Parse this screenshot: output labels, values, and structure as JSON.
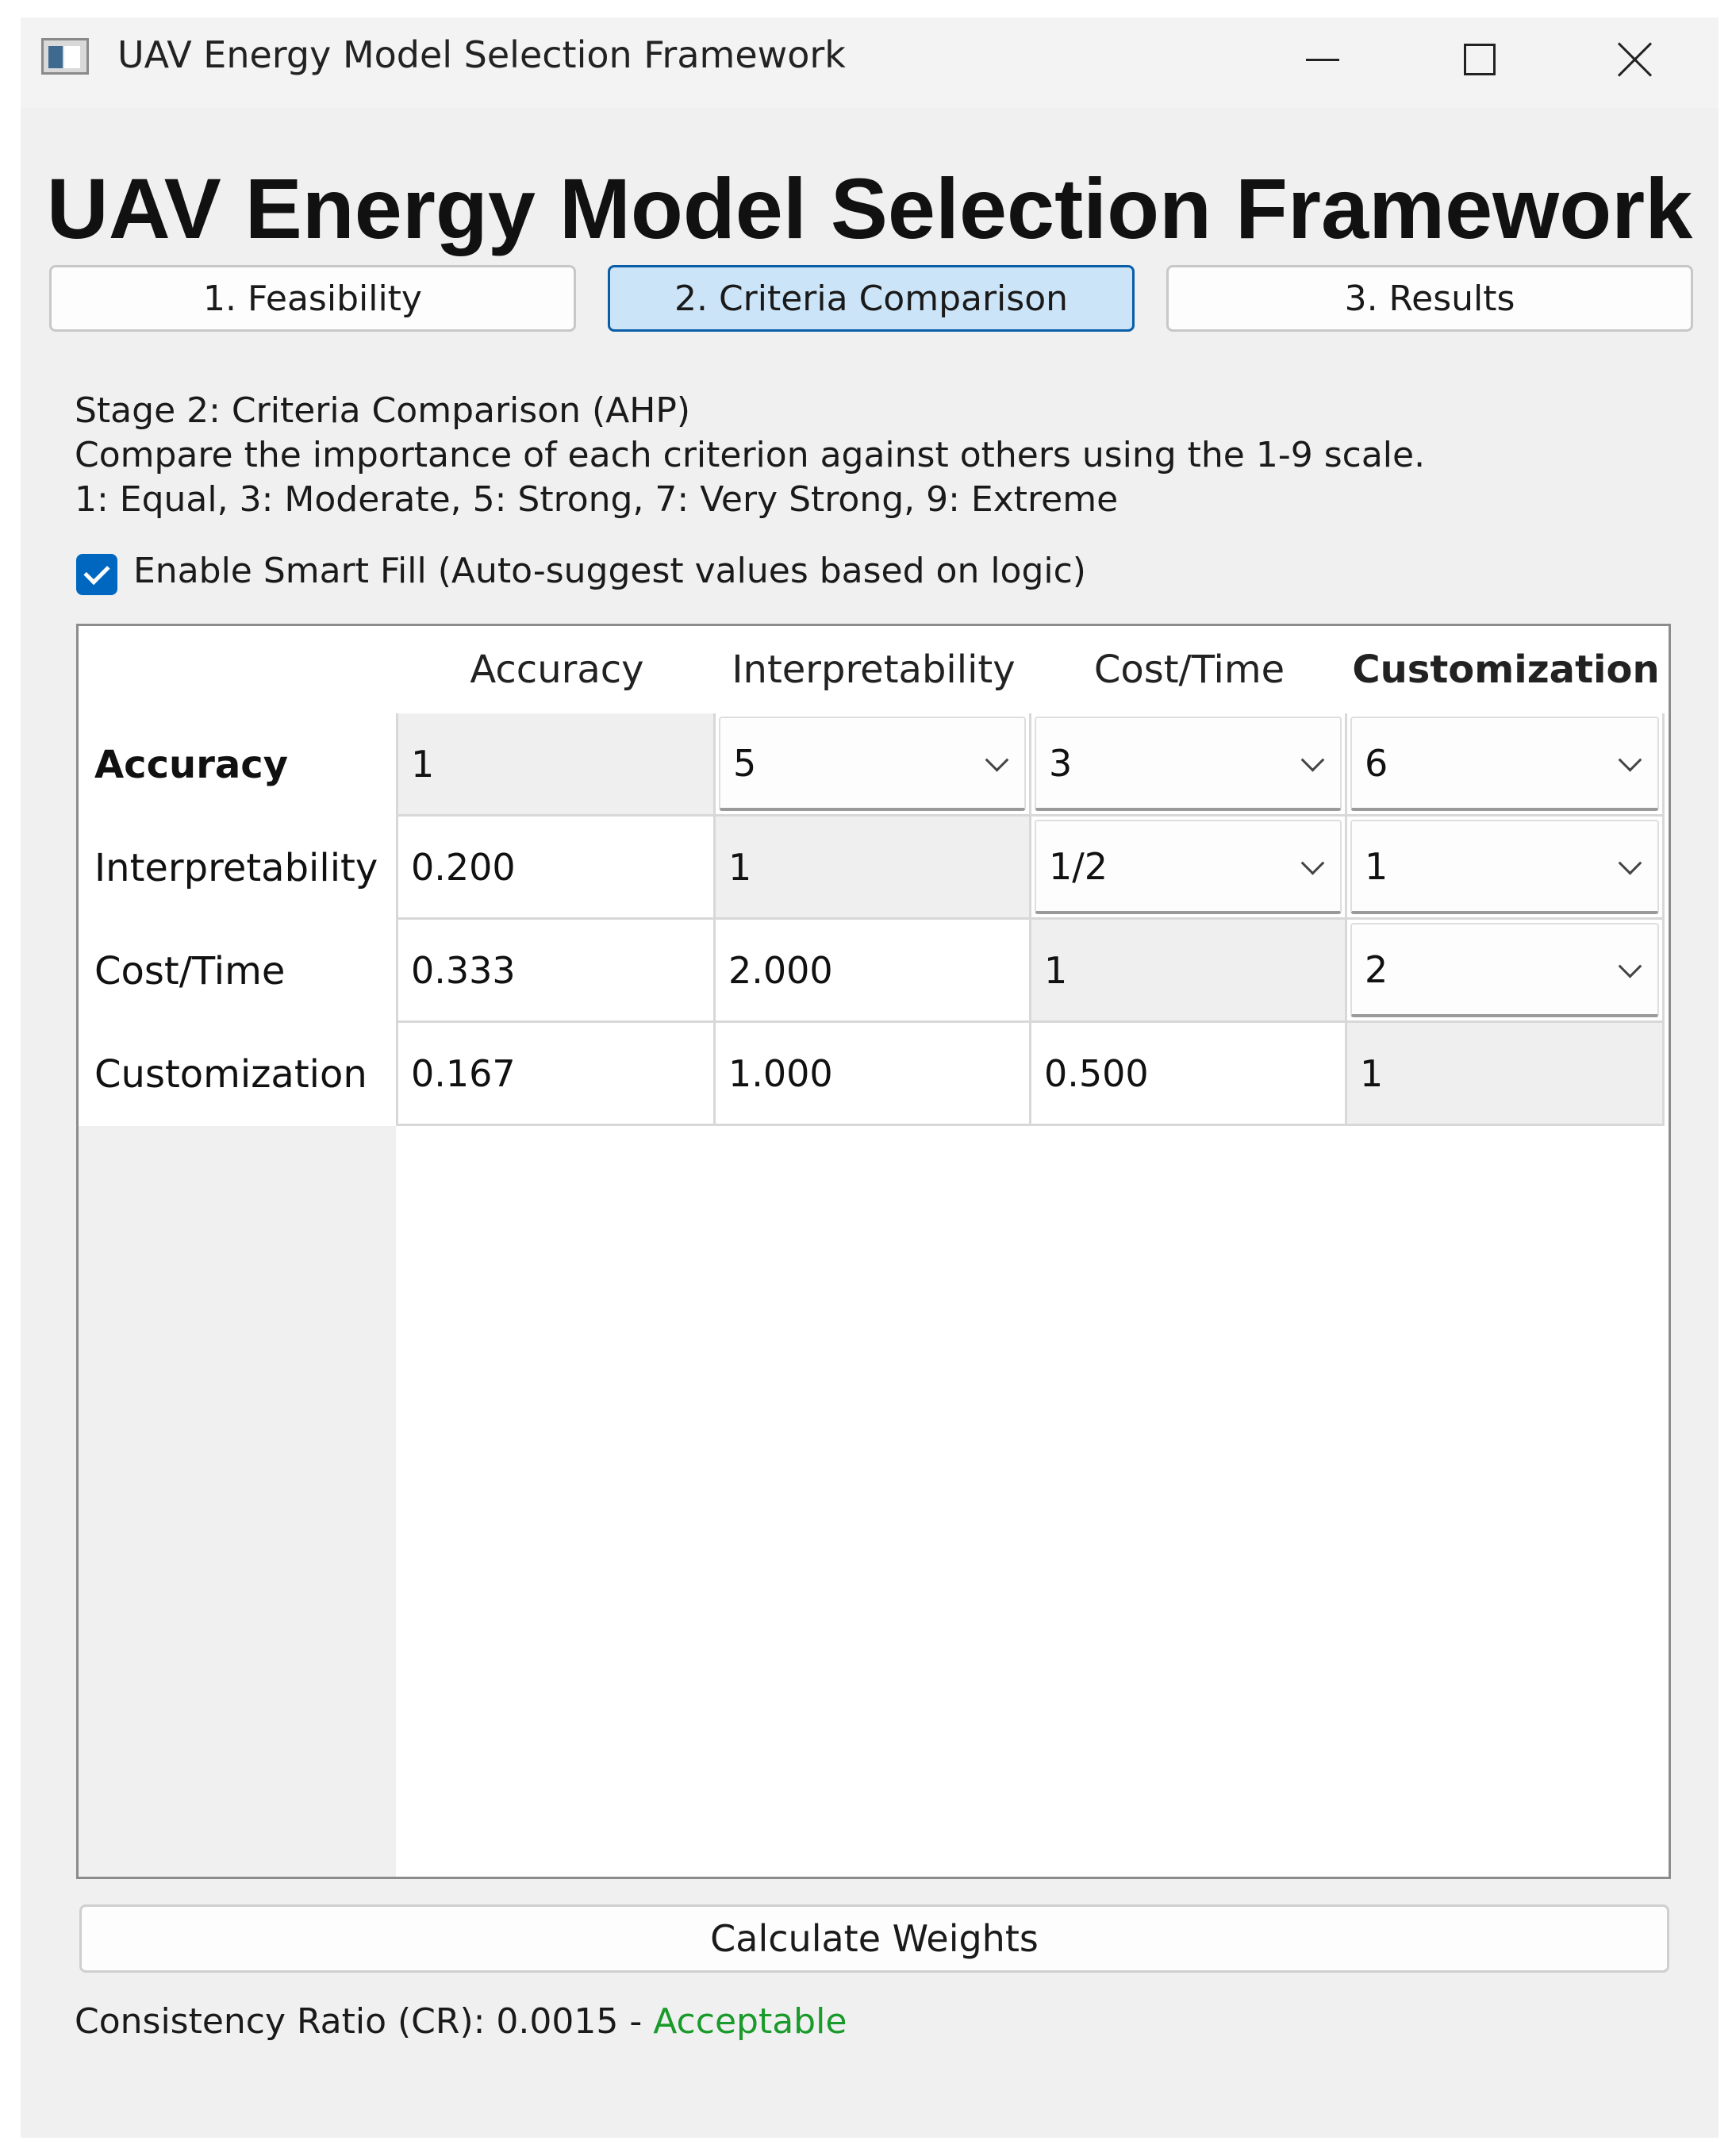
{
  "window": {
    "title": "UAV Energy Model Selection Framework"
  },
  "header": {
    "title": "UAV Energy Model Selection Framework"
  },
  "stages": [
    {
      "label": "1. Feasibility",
      "active": false
    },
    {
      "label": "2. Criteria Comparison",
      "active": true
    },
    {
      "label": "3. Results",
      "active": false
    }
  ],
  "instructions": {
    "line1": "Stage 2: Criteria Comparison (AHP)",
    "line2": "Compare the importance of each criterion against others using the 1-9 scale.",
    "line3": "1: Equal, 3: Moderate, 5: Strong, 7: Very Strong, 9: Extreme"
  },
  "smart_fill": {
    "label": "Enable Smart Fill (Auto-suggest values based on logic)",
    "checked": true
  },
  "matrix": {
    "columns": [
      "Accuracy",
      "Interpretability",
      "Cost/Time",
      "Customization"
    ],
    "rows": [
      {
        "label": "Accuracy",
        "cells": [
          "1",
          "5",
          "3",
          "6"
        ]
      },
      {
        "label": "Interpretability",
        "cells": [
          "0.200",
          "1",
          "1/2",
          "1"
        ]
      },
      {
        "label": "Cost/Time",
        "cells": [
          "0.333",
          "2.000",
          "1",
          "2"
        ]
      },
      {
        "label": "Customization",
        "cells": [
          "0.167",
          "1.000",
          "0.500",
          "1"
        ]
      }
    ]
  },
  "actions": {
    "calculate_label": "Calculate Weights"
  },
  "result": {
    "cr_prefix": "Consistency Ratio (CR): 0.0015 - ",
    "cr_status": "Acceptable",
    "status_color": "#1a9a2a"
  },
  "colors": {
    "accent": "#0067c0",
    "active_tab_bg": "#cce4f7"
  }
}
